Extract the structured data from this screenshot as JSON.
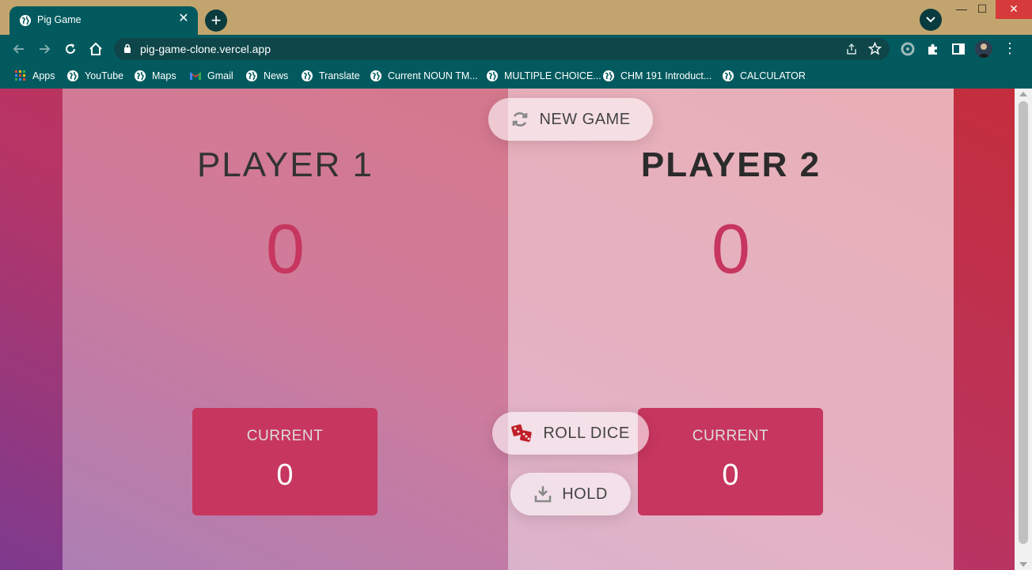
{
  "browser": {
    "tab_title": "Pig Game",
    "tab_close": "✕",
    "new_tab": "+",
    "url": "pig-game-clone.vercel.app",
    "window_controls": {
      "minimize": "—",
      "maximize": "☐",
      "close": "✕"
    },
    "bookmarks": [
      {
        "label": "Apps",
        "icon": "apps-grid-icon"
      },
      {
        "label": "YouTube",
        "icon": "globe-icon"
      },
      {
        "label": "Maps",
        "icon": "globe-icon"
      },
      {
        "label": "Gmail",
        "icon": "gmail-icon"
      },
      {
        "label": "News",
        "icon": "globe-icon"
      },
      {
        "label": "Translate",
        "icon": "globe-icon"
      },
      {
        "label": "Current NOUN TM...",
        "icon": "globe-icon"
      },
      {
        "label": "MULTIPLE CHOICE...",
        "icon": "globe-icon"
      },
      {
        "label": "CHM 191 Introduct...",
        "icon": "globe-icon"
      },
      {
        "label": "CALCULATOR",
        "icon": "globe-icon"
      }
    ],
    "colors": {
      "frame": "#c2a56e",
      "toolbar": "#025a5f"
    }
  },
  "game": {
    "new_game_label": "NEW GAME",
    "roll_dice_label": "ROLL DICE",
    "hold_label": "HOLD",
    "players": [
      {
        "name": "PLAYER 1",
        "score": "0",
        "current_label": "CURRENT",
        "current_score": "0",
        "active": false
      },
      {
        "name": "PLAYER 2",
        "score": "0",
        "current_label": "CURRENT",
        "current_score": "0",
        "active": true
      }
    ],
    "colors": {
      "accent": "#c7365f",
      "bg_start": "#c42d3c",
      "bg_end": "#7d3a8e"
    }
  }
}
